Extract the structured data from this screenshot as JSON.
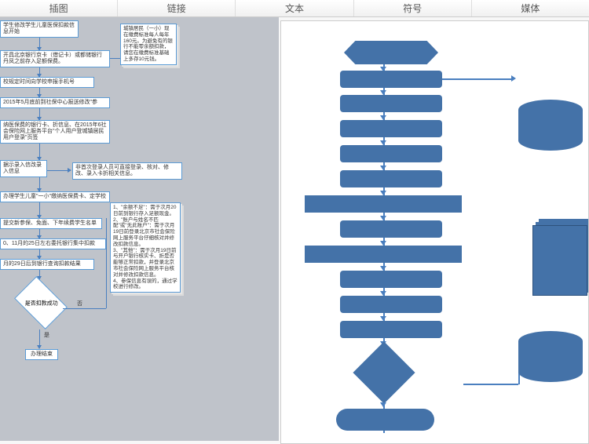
{
  "ribbon": {
    "tabs": [
      "插图",
      "链接",
      "文本",
      "符号",
      "媒体"
    ]
  },
  "thumb": {
    "start": "学生修改学生儿童医保扣款信息开始",
    "b1": "开具北京银行京卡（借记卡）或都储银行丹凤之前存入足额保费。",
    "note1": "城镇居民（一小）现在缴费标准每人每年160元。为避免有的银行不能零余额扣款，请您在缴费标准基础上多存10元钱。",
    "b2": "校规定时间向学校申报手机号",
    "b3": "2015年5月底前到社保中心报送修改\"参",
    "b4": "纳医保费的银行卡、折信息、在2015年6社会保险网上服务平台\"个人用户登城镇居民用户登录\"页签",
    "b5": "据示录入信改录入信息",
    "note2": "非首次登录人员可直接登录、核对、修改、录入卡折相关信息。",
    "b6": "办理学生儿童\"一小\"缴纳医保费卡、定学校",
    "b7": "提交新参保、免面、下年续费学生名单",
    "b8": "0、11月的25日左右委托银行集中扣款",
    "b9": "月的29日后到银行查询扣款结果",
    "note3": "1、\"余额不足\"：需于次月20日前到银行存入足额现金。\n2、\"账户与姓名不匹配\"或\"无此账户\"：需于次月19日前登录北京市社会保险网上服务平台仔细核对并修改扣款信息。\n3、\"其他\"：需于次月19日前与开户银行核实卡、折是否能够正常扣款，并登录北京市社会保险网上服务平台核对并修改扣款信息。\n4、参保信息有误的，通过学校进行修改。",
    "diamond": "是否扣款成功",
    "yes": "是",
    "no": "否",
    "end": "办理结束"
  }
}
